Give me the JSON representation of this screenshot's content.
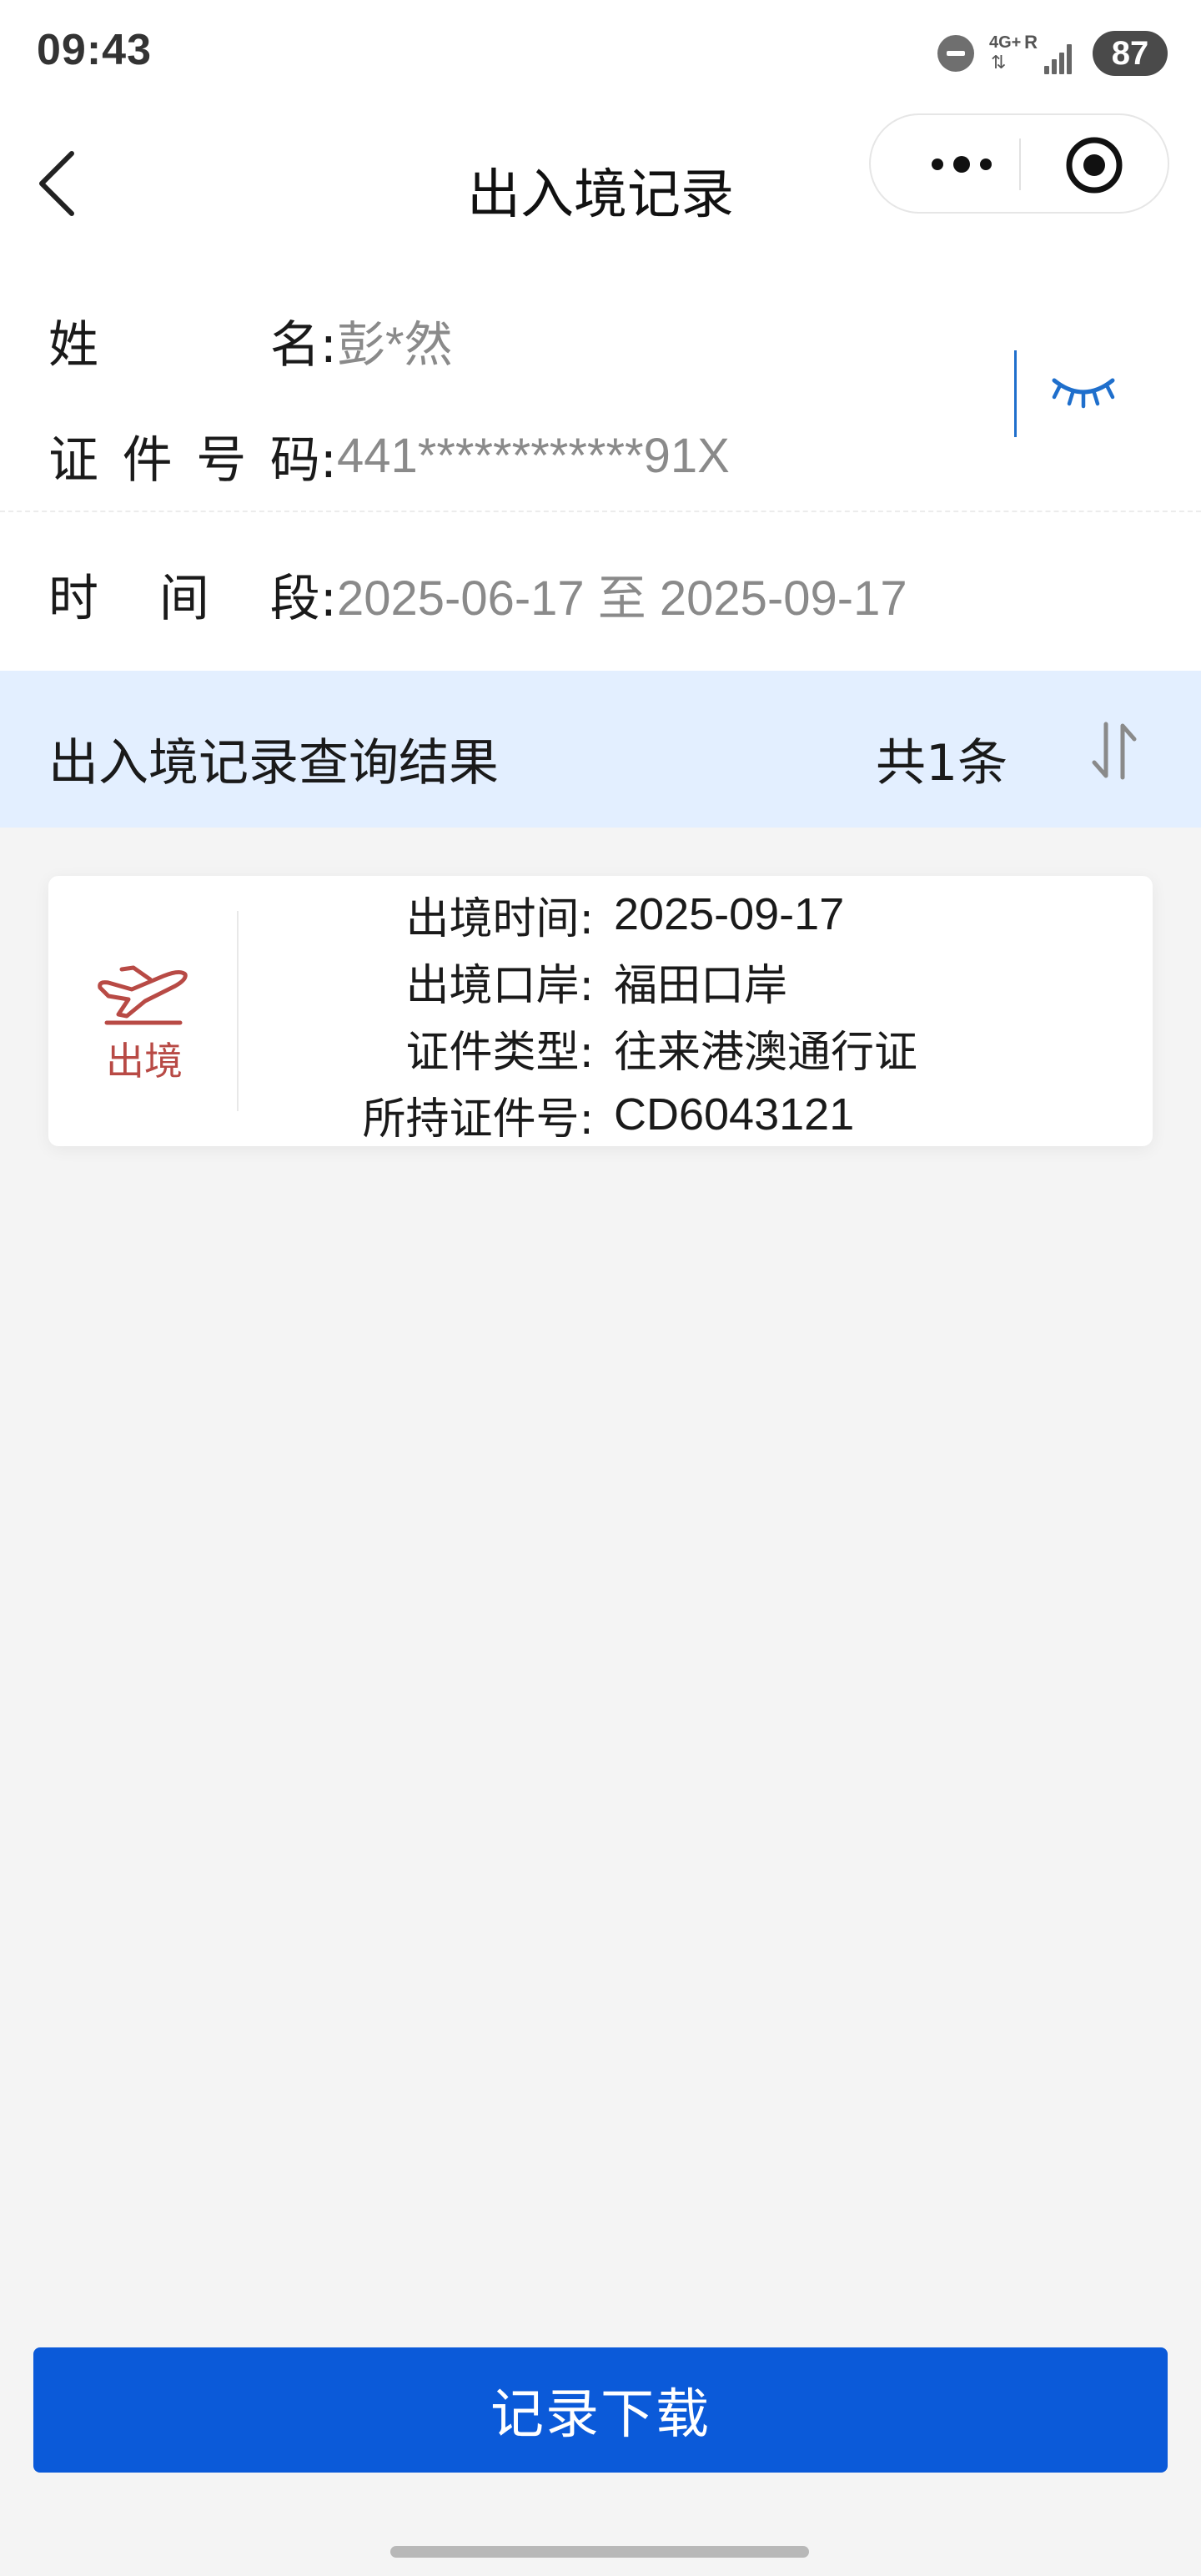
{
  "status_bar": {
    "time": "09:43",
    "network": "4G+",
    "roaming": "R",
    "battery": "87"
  },
  "nav": {
    "title": "出入境记录"
  },
  "info": {
    "name": {
      "label_chars": [
        "姓",
        "名:"
      ],
      "value": "彭*然"
    },
    "id_number": {
      "label_chars": [
        "证",
        "件",
        "号",
        "码:"
      ],
      "value": "441************91X"
    },
    "period": {
      "label_chars": [
        "时",
        "间",
        "段:"
      ],
      "value": "2025-06-17 至 2025-09-17"
    }
  },
  "results": {
    "title": "出入境记录查询结果",
    "count": "共1条"
  },
  "records": [
    {
      "direction": "出境",
      "fields": [
        {
          "label": "出境时间:",
          "value": "2025-09-17"
        },
        {
          "label": "出境口岸:",
          "value": "福田口岸"
        },
        {
          "label": "证件类型:",
          "value": "往来港澳通行证"
        },
        {
          "label": "所持证件号:",
          "value": "CD6043121"
        }
      ]
    }
  ],
  "download_label": "记录下载",
  "colors": {
    "accent_blue": "#0b5ad9",
    "result_header_bg": "#e3efff",
    "exit_red": "#b84a45",
    "eye_blue": "#1f6fcc"
  },
  "icons": {
    "back": "chevron-left-icon",
    "more": "more-dots-icon",
    "close": "target-circle-icon",
    "eye": "eye-closed-icon",
    "sort": "sort-arrows-icon",
    "plane": "plane-departure-icon"
  }
}
